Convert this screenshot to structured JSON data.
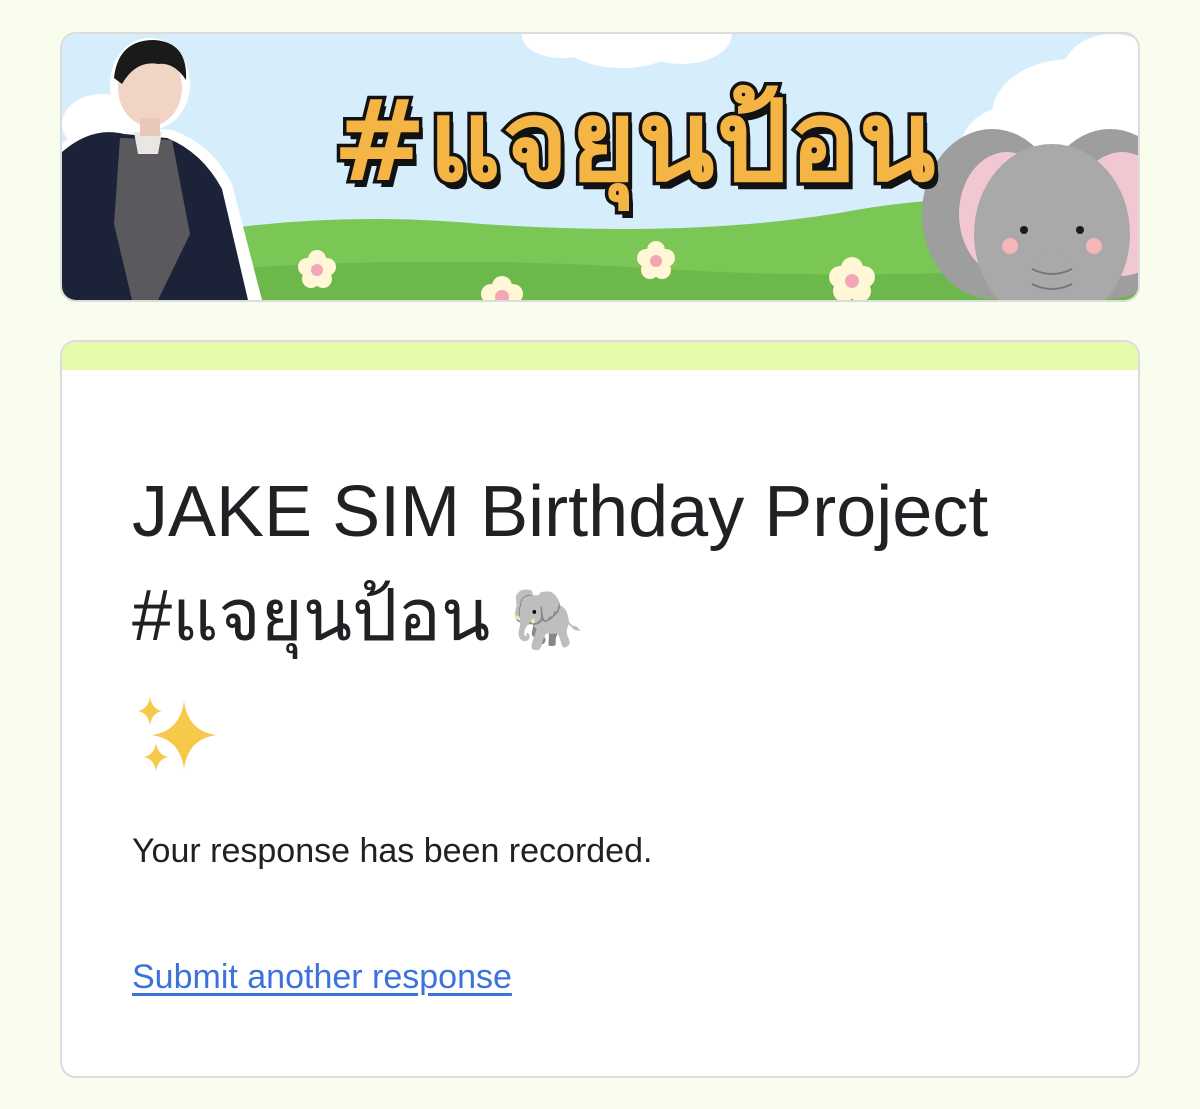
{
  "banner": {
    "title_art": "#แจยุนป้อน",
    "colors": {
      "sky": "#d6edfb",
      "grass": "#7ac756",
      "title_fill": "#f4b544",
      "title_outline": "#121212"
    },
    "icons": [
      "person-photo",
      "elephant-illustration",
      "flower-icon",
      "cloud-icon"
    ]
  },
  "form": {
    "title_text": "JAKE SIM Birthday Project #แจยุนป้อน",
    "title_emoji": "🐘",
    "title_sparkles_icon": "sparkles-icon",
    "confirmation": "Your response has been recorded.",
    "another_link": "Submit another response",
    "colors": {
      "accent_bar": "#e6fbaa",
      "link": "#3b73db",
      "background": "#f8fdee"
    }
  }
}
